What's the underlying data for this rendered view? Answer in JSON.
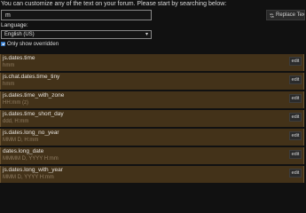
{
  "intro_text": "You can customize any of the text on your forum. Please start by searching below:",
  "search": {
    "value": "m"
  },
  "replace_button": {
    "label": "Replace Text...",
    "icon": "sync-icon"
  },
  "language": {
    "label": "Language:",
    "selected": "English (US)"
  },
  "only_overridden": {
    "label": "Only show overridden",
    "checked": true
  },
  "overrides": [
    {
      "key": "js.dates.time",
      "value": "hmm",
      "edit_label": "edit"
    },
    {
      "key": "js.chat.dates.time_tiny",
      "value": "hmm",
      "edit_label": "edit"
    },
    {
      "key": "js.dates.time_with_zone",
      "value": "HH:mm (z)",
      "edit_label": "edit"
    },
    {
      "key": "js.dates.time_short_day",
      "value": "ddd, H:mm",
      "edit_label": "edit"
    },
    {
      "key": "js.dates.long_no_year",
      "value": "MMM D, H:mm",
      "edit_label": "edit"
    },
    {
      "key": "dates.long_date",
      "value": "MMMM D, YYYY H:mm",
      "edit_label": "edit"
    },
    {
      "key": "js.dates.long_with_year",
      "value": "MMM D, YYYY H:mm",
      "edit_label": "edit"
    }
  ],
  "colors": {
    "background": "#111111",
    "row_background": "#433219",
    "row_key_text": "#e6e2dc",
    "row_value_text": "#907d63",
    "checkbox": "#4a8edc"
  }
}
